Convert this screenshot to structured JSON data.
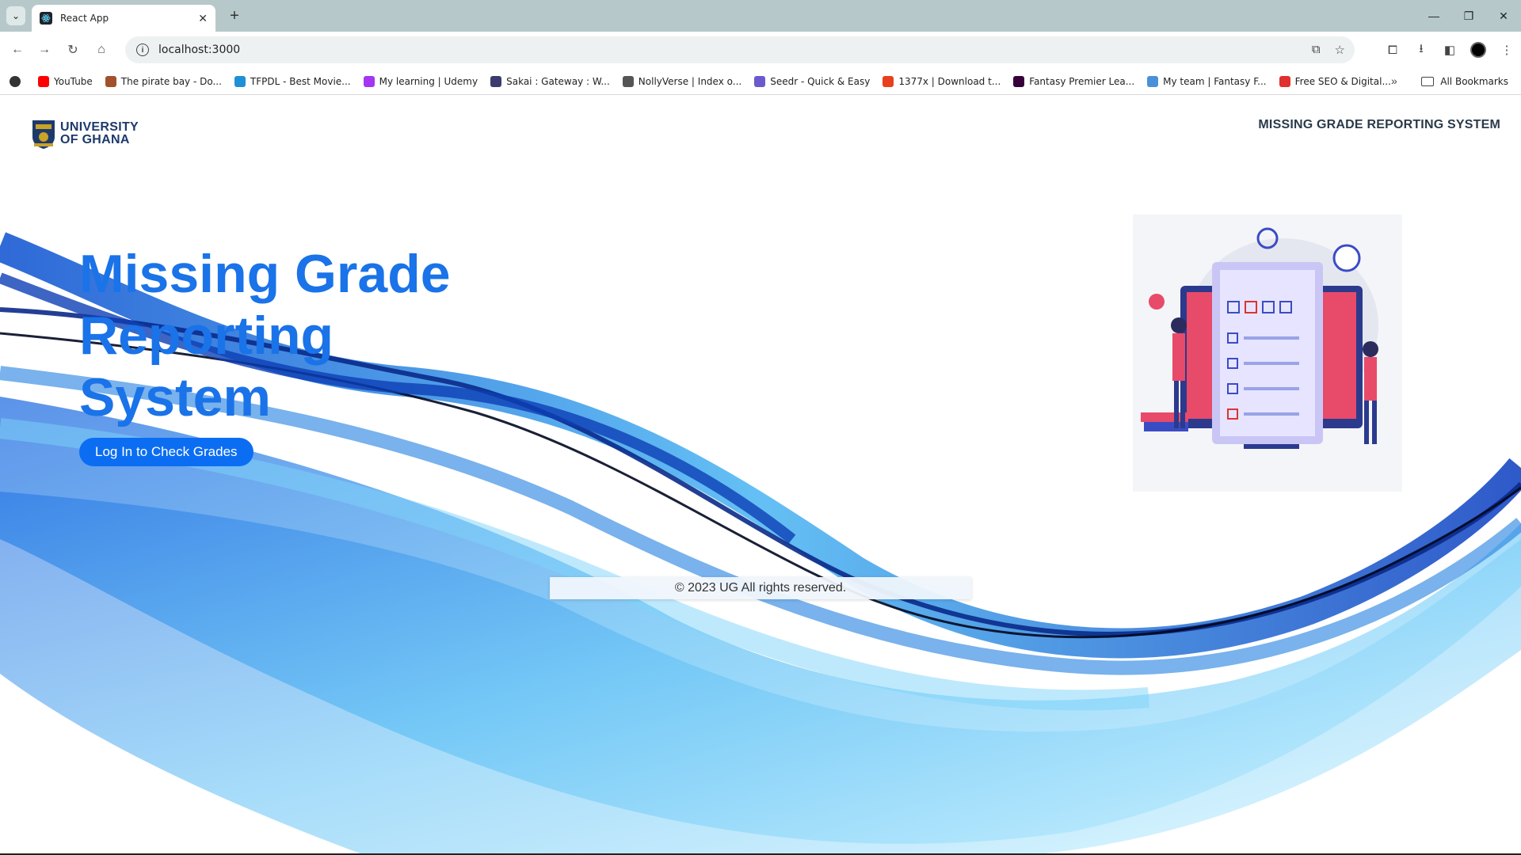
{
  "browser": {
    "tab_title": "React App",
    "url": "localhost:3000",
    "bookmarks": [
      {
        "label": "YouTube",
        "color": "#ff0000"
      },
      {
        "label": "The pirate bay - Do...",
        "color": "#a0522d"
      },
      {
        "label": "TFPDL - Best Movie...",
        "color": "#1e90d6"
      },
      {
        "label": "My learning | Udemy",
        "color": "#a435f0"
      },
      {
        "label": "Sakai : Gateway : W...",
        "color": "#3b3b6d"
      },
      {
        "label": "NollyVerse | Index o...",
        "color": "#555555"
      },
      {
        "label": "Seedr - Quick & Easy",
        "color": "#6a5acd"
      },
      {
        "label": "1377x | Download t...",
        "color": "#e8401c"
      },
      {
        "label": "Fantasy Premier Lea...",
        "color": "#37003c"
      },
      {
        "label": "My team | Fantasy F...",
        "color": "#4a90d9"
      },
      {
        "label": "Free SEO & Digital...",
        "color": "#e03030"
      }
    ],
    "all_bookmarks": "All Bookmarks"
  },
  "header": {
    "logo_line1": "UNIVERSITY",
    "logo_line2": "OF GHANA",
    "title": "MISSING GRADE REPORTING SYSTEM"
  },
  "hero": {
    "title": "Missing Grade Reporting System",
    "cta_label": "Log In to Check Grades"
  },
  "footer": {
    "copyright": "© 2023 UG All rights reserved."
  },
  "colors": {
    "accent": "#1a73e8",
    "button": "#0b6ef2"
  }
}
